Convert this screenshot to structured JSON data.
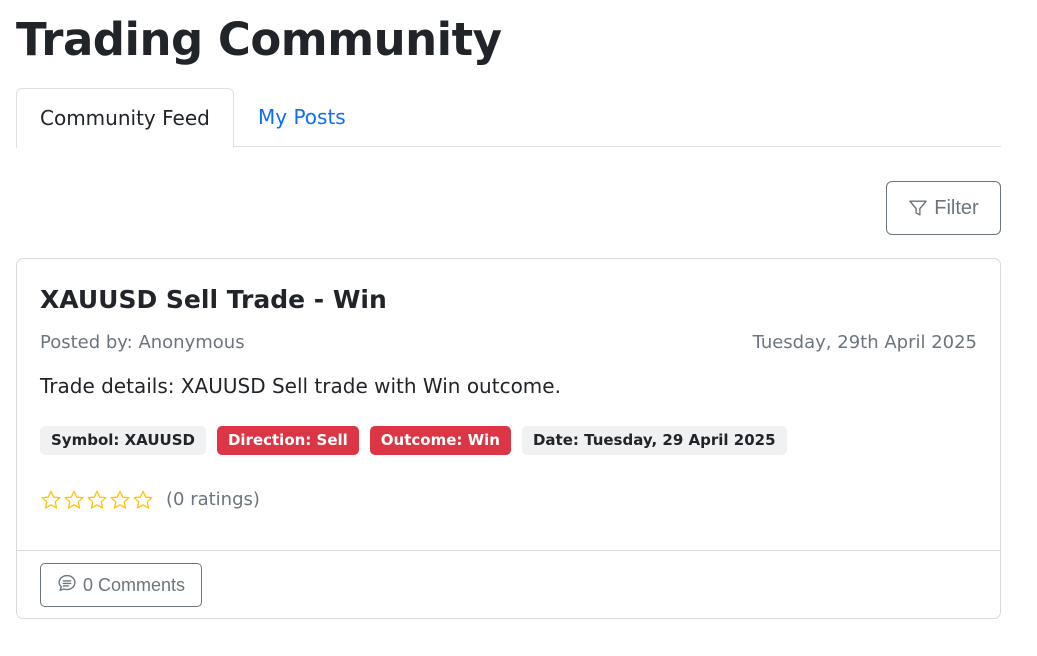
{
  "page": {
    "title": "Trading Community"
  },
  "tabs": [
    {
      "label": "Community Feed",
      "active": true
    },
    {
      "label": "My Posts",
      "active": false
    }
  ],
  "toolbar": {
    "filter_label": "Filter",
    "filter_icon": "filter-icon"
  },
  "post": {
    "title": "XAUUSD Sell Trade - Win",
    "posted_by": "Posted by: Anonymous",
    "date": "Tuesday, 29th April 2025",
    "details": "Trade details: XAUUSD Sell trade with Win outcome.",
    "badges": [
      {
        "label": "Symbol: XAUUSD",
        "style": "light"
      },
      {
        "label": "Direction: Sell",
        "style": "danger"
      },
      {
        "label": "Outcome: Win",
        "style": "danger"
      },
      {
        "label": "Date: Tuesday, 29 April 2025",
        "style": "light"
      }
    ],
    "rating": {
      "value": 0,
      "max": 5,
      "count_label": "(0 ratings)",
      "star_color": "#ffc107"
    },
    "comments_label": "0 Comments",
    "comments_icon": "chat-icon"
  },
  "colors": {
    "primary": "#0d6efd",
    "danger": "#dc3545",
    "secondary": "#6c757d"
  }
}
